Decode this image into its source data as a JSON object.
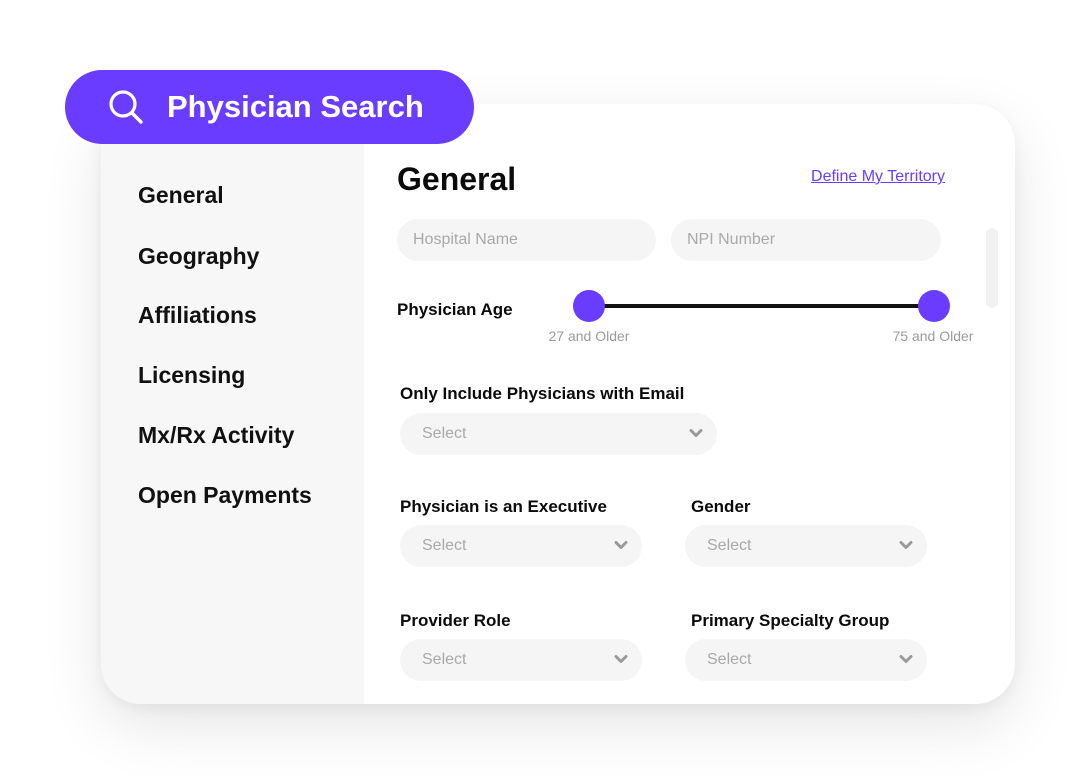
{
  "header": {
    "title": "Physician Search",
    "icon": "search-icon",
    "accent_color": "#6a3cff"
  },
  "sidebar": {
    "items": [
      {
        "label": "General"
      },
      {
        "label": "Geography"
      },
      {
        "label": "Affiliations"
      },
      {
        "label": "Licensing"
      },
      {
        "label": "Mx/Rx Activity"
      },
      {
        "label": "Open Payments"
      }
    ]
  },
  "main": {
    "title": "General",
    "territory_link": "Define My Territory",
    "hospital_name": {
      "placeholder": "Hospital Name",
      "value": ""
    },
    "npi_number": {
      "placeholder": "NPI Number",
      "value": ""
    },
    "physician_age": {
      "label": "Physician Age",
      "min_caption": "27 and Older",
      "max_caption": "75 and Older",
      "min_value": 27,
      "max_value": 75
    },
    "email_filter": {
      "label": "Only Include Physicians with Email",
      "value": "Select"
    },
    "executive_filter": {
      "label": "Physician is an Executive",
      "value": "Select"
    },
    "gender_filter": {
      "label": "Gender",
      "value": "Select"
    },
    "provider_role": {
      "label": "Provider Role",
      "value": "Select"
    },
    "specialty_group": {
      "label": "Primary Specialty Group",
      "value": "Select"
    }
  }
}
